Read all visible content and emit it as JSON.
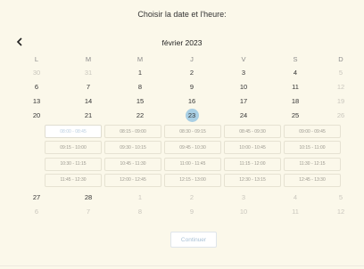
{
  "header": {
    "title": "Choisir la date et l'heure:",
    "month": "février 2023"
  },
  "weekdays": [
    "L",
    "M",
    "M",
    "J",
    "V",
    "S",
    "D"
  ],
  "weeks_top": [
    [
      "30",
      "31",
      "1",
      "2",
      "3",
      "4",
      "5"
    ],
    [
      "6",
      "7",
      "8",
      "9",
      "10",
      "11",
      "12"
    ],
    [
      "13",
      "14",
      "15",
      "16",
      "17",
      "18",
      "19"
    ],
    [
      "20",
      "21",
      "22",
      "23",
      "24",
      "25",
      "26"
    ]
  ],
  "weeks_bottom": [
    [
      "27",
      "28",
      "1",
      "2",
      "3",
      "4",
      "5"
    ],
    [
      "6",
      "7",
      "8",
      "9",
      "10",
      "11",
      "12"
    ]
  ],
  "selected_date": "23",
  "slots": [
    "08:00 - 08:45",
    "08:15 - 09:00",
    "08:30 - 09:15",
    "08:45 - 09:30",
    "09:00 - 09:45",
    "09:15 - 10:00",
    "09:30 - 10:15",
    "09:45 - 10:30",
    "10:00 - 10:45",
    "10:15 - 11:00",
    "10:30 - 11:15",
    "10:45 - 11:30",
    "11:00 - 11:45",
    "11:15 - 12:00",
    "11:30 - 12:15",
    "11:45 - 12:30",
    "12:00 - 12:45",
    "12:15 - 13:00",
    "12:30 - 13:15",
    "12:45 - 13:30"
  ],
  "actions": {
    "continue_label": "Continuer"
  },
  "colors": {
    "background": "#fbf8ea",
    "selected": "#a9cfe4",
    "button_text": "#a8c1d6"
  }
}
